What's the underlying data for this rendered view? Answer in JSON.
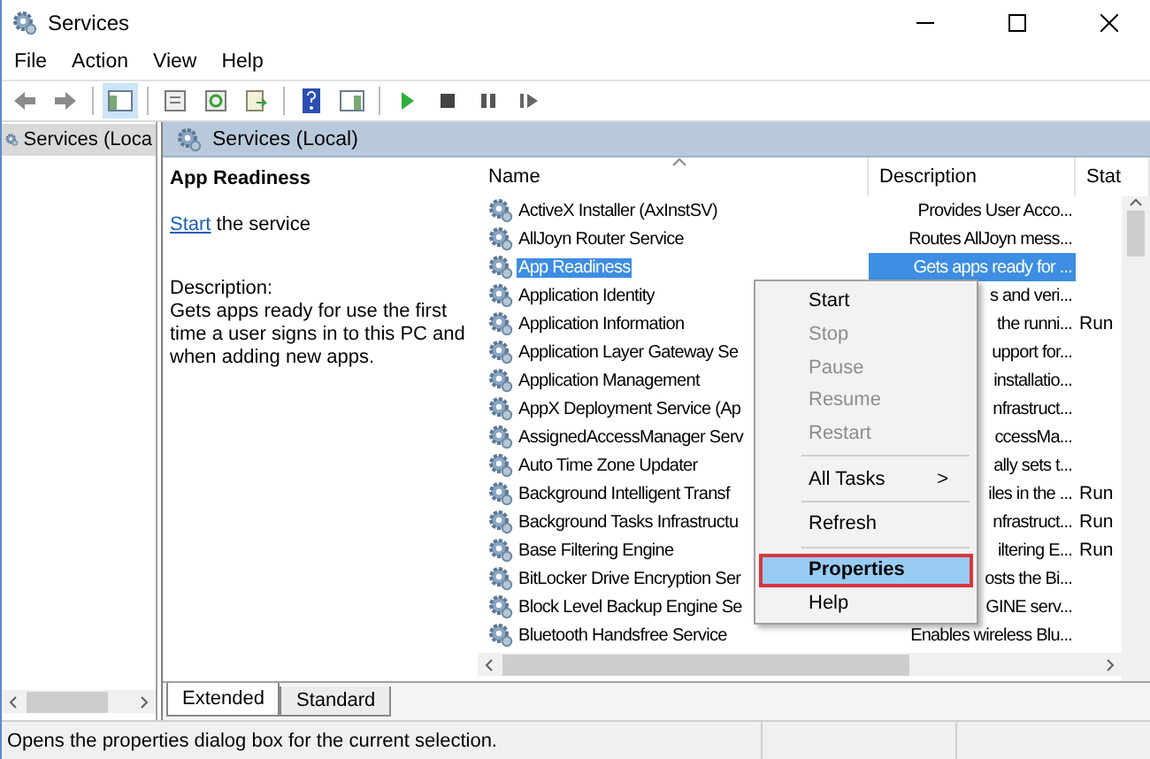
{
  "window": {
    "title": "Services"
  },
  "menu": [
    "File",
    "Action",
    "View",
    "Help"
  ],
  "tree": {
    "items": [
      {
        "label": "Services (Loca",
        "selected": true
      }
    ]
  },
  "panel": {
    "title": "Services (Local)"
  },
  "details": {
    "service_name": "App Readiness",
    "action_link": "Start",
    "action_text": " the service",
    "description_label": "Description:",
    "description": "Gets apps ready for use the first time a user signs in to this PC and when adding new apps."
  },
  "table": {
    "columns": [
      "Name",
      "Description",
      "Stat"
    ],
    "rows": [
      {
        "name": "ActiveX Installer (AxInstSV)",
        "description": "Provides User Acco...",
        "status": "",
        "selected": false
      },
      {
        "name": "AllJoyn Router Service",
        "description": "Routes AllJoyn mess...",
        "status": "",
        "selected": false
      },
      {
        "name": "App Readiness",
        "description": "Gets apps ready for ...",
        "status": "",
        "selected": true
      },
      {
        "name": "Application Identity",
        "description": "s and veri...",
        "status": "",
        "selected": false
      },
      {
        "name": "Application Information",
        "description": "the runni...",
        "status": "Run",
        "selected": false
      },
      {
        "name": "Application Layer Gateway Se",
        "description": "upport for...",
        "status": "",
        "selected": false
      },
      {
        "name": "Application Management",
        "description": "installatio...",
        "status": "",
        "selected": false
      },
      {
        "name": "AppX Deployment Service (Ap",
        "description": "nfrastruct...",
        "status": "",
        "selected": false
      },
      {
        "name": "AssignedAccessManager Serv",
        "description": "ccessMa...",
        "status": "",
        "selected": false
      },
      {
        "name": "Auto Time Zone Updater",
        "description": "ally sets t...",
        "status": "",
        "selected": false
      },
      {
        "name": "Background Intelligent Transf",
        "description": "iles in the ...",
        "status": "Run",
        "selected": false
      },
      {
        "name": "Background Tasks Infrastructu",
        "description": "nfrastruct...",
        "status": "Run",
        "selected": false
      },
      {
        "name": "Base Filtering Engine",
        "description": "iltering E...",
        "status": "Run",
        "selected": false
      },
      {
        "name": "BitLocker Drive Encryption Ser",
        "description": "osts the Bi...",
        "status": "",
        "selected": false
      },
      {
        "name": "Block Level Backup Engine Se",
        "description": "GINE serv...",
        "status": "",
        "selected": false
      },
      {
        "name": "Bluetooth Handsfree Service",
        "description": "Enables wireless Blu...",
        "status": "",
        "selected": false
      }
    ]
  },
  "tabs": [
    {
      "label": "Extended",
      "selected": true
    },
    {
      "label": "Standard",
      "selected": false
    }
  ],
  "context_menu": [
    {
      "kind": "item",
      "label": "Start",
      "disabled": false,
      "selected": false
    },
    {
      "kind": "item",
      "label": "Stop",
      "disabled": true,
      "selected": false
    },
    {
      "kind": "item",
      "label": "Pause",
      "disabled": true,
      "selected": false
    },
    {
      "kind": "item",
      "label": "Resume",
      "disabled": true,
      "selected": false
    },
    {
      "kind": "item",
      "label": "Restart",
      "disabled": true,
      "selected": false
    },
    {
      "kind": "separator"
    },
    {
      "kind": "item",
      "label": "All Tasks",
      "arrow": ">",
      "disabled": false,
      "selected": false
    },
    {
      "kind": "separator"
    },
    {
      "kind": "item",
      "label": "Refresh",
      "disabled": false,
      "selected": false
    },
    {
      "kind": "separator"
    },
    {
      "kind": "item",
      "label": "Properties",
      "disabled": false,
      "selected": true
    },
    {
      "kind": "item",
      "label": "Help",
      "disabled": false,
      "selected": false
    }
  ],
  "status_bar": "Opens the properties dialog box for the current selection."
}
